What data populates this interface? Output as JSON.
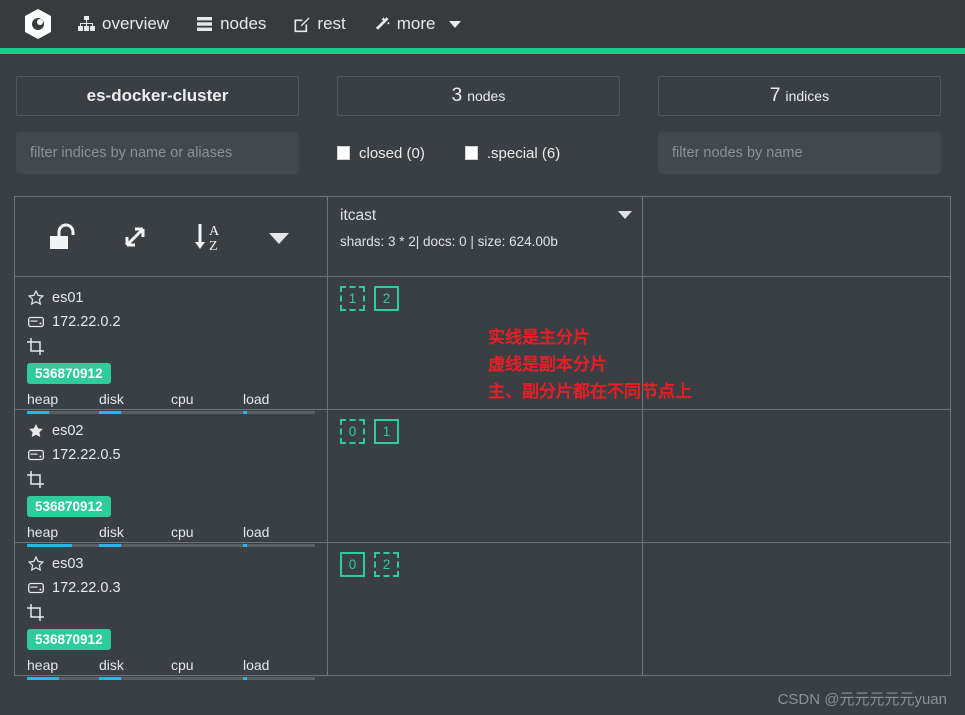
{
  "navbar": {
    "brand_icon": "elasticsearch-cerebro-logo-icon",
    "items": [
      {
        "label": "overview",
        "icon": "sitemap-icon"
      },
      {
        "label": "nodes",
        "icon": "server-stack-icon"
      },
      {
        "label": "rest",
        "icon": "pencil-square-icon"
      },
      {
        "label": "more",
        "icon": "magic-wand-icon",
        "has_caret": true
      }
    ],
    "accent_color": "#22c98a"
  },
  "summary": {
    "cluster_name": "es-docker-cluster",
    "nodes_count": "3",
    "nodes_label": "nodes",
    "indices_count": "7",
    "indices_label": "indices"
  },
  "filters": {
    "indices_placeholder": "filter indices by name or aliases",
    "indices_value": "",
    "nodes_placeholder": "filter nodes by name",
    "nodes_value": "",
    "checkboxes": [
      {
        "label": "closed (0)",
        "checked": false
      },
      {
        "label": ".special (6)",
        "checked": false
      }
    ]
  },
  "grid": {
    "toolbar": [
      {
        "icon": "unlock-icon",
        "name": "toggle-lock-button"
      },
      {
        "icon": "expand-arrows-icon",
        "name": "expand-button"
      },
      {
        "icon": "sort-alpha-asc-icon",
        "name": "sort-az-button"
      },
      {
        "icon": "chevron-down-icon",
        "name": "options-caret-button"
      }
    ],
    "index": {
      "name": "itcast",
      "meta": "shards: 3 * 2| docs: 0 | size: 624.00b"
    },
    "nodes": [
      {
        "name": "es01",
        "master": false,
        "star_icon": "star-outline-icon",
        "ip": "172.22.0.2",
        "ip_icon": "hdd-icon",
        "tag_icon": "crop-icon",
        "memory": "536870912",
        "metrics": [
          {
            "label": "heap",
            "pct": 30
          },
          {
            "label": "disk",
            "pct": 30
          },
          {
            "label": "cpu",
            "pct": 0
          },
          {
            "label": "load",
            "pct": 5
          }
        ],
        "shards": [
          {
            "num": "1",
            "type": "replica"
          },
          {
            "num": "2",
            "type": "primary"
          }
        ]
      },
      {
        "name": "es02",
        "master": true,
        "star_icon": "star-filled-icon",
        "ip": "172.22.0.5",
        "ip_icon": "hdd-icon",
        "tag_icon": "crop-icon",
        "memory": "536870912",
        "metrics": [
          {
            "label": "heap",
            "pct": 62
          },
          {
            "label": "disk",
            "pct": 30
          },
          {
            "label": "cpu",
            "pct": 0
          },
          {
            "label": "load",
            "pct": 5
          }
        ],
        "shards": [
          {
            "num": "0",
            "type": "replica"
          },
          {
            "num": "1",
            "type": "primary"
          }
        ]
      },
      {
        "name": "es03",
        "master": false,
        "star_icon": "star-outline-icon",
        "ip": "172.22.0.3",
        "ip_icon": "hdd-icon",
        "tag_icon": "crop-icon",
        "memory": "536870912",
        "metrics": [
          {
            "label": "heap",
            "pct": 45
          },
          {
            "label": "disk",
            "pct": 30
          },
          {
            "label": "cpu",
            "pct": 0
          },
          {
            "label": "load",
            "pct": 5
          }
        ],
        "shards": [
          {
            "num": "0",
            "type": "primary"
          },
          {
            "num": "2",
            "type": "replica"
          }
        ]
      }
    ]
  },
  "annotation": {
    "text": "实线是主分片\n虚线是副本分片\n主、副分片都在不同节点上",
    "color": "#ed1c24"
  },
  "watermark": {
    "text": "CSDN @元元元元元yuan"
  }
}
